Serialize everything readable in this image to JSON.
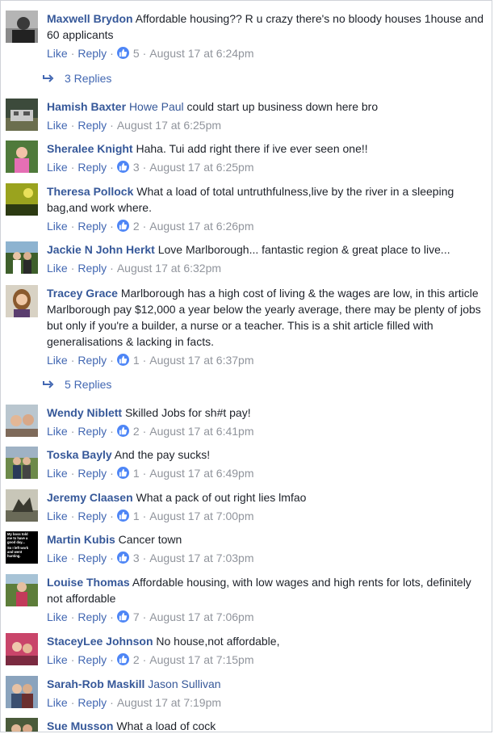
{
  "labels": {
    "like": "Like",
    "reply": "Reply",
    "separator": "·"
  },
  "comments": [
    {
      "author": "Maxwell Brydon",
      "mention": "",
      "text": "Affordable housing?? R u crazy there's no bloody houses 1house and 60 applicants",
      "reactions": "5",
      "time": "August 17 at 6:24pm"
    },
    {
      "author": "Hamish Baxter",
      "mention": "Howe Paul",
      "text": "could start up business down here bro",
      "reactions": "",
      "time": "August 17 at 6:25pm"
    },
    {
      "author": "Sheralee Knight",
      "mention": "",
      "text": "Haha. Tui add right there if ive ever seen one!!",
      "reactions": "3",
      "time": "August 17 at 6:25pm"
    },
    {
      "author": "Theresa Pollock",
      "mention": "",
      "text": "What a load of total untruthfulness,live by the river in a sleeping bag,and work where.",
      "reactions": "2",
      "time": "August 17 at 6:26pm"
    },
    {
      "author": "Jackie N John Herkt",
      "mention": "",
      "text": "Love Marlborough... fantastic region & great place to live...",
      "reactions": "",
      "time": "August 17 at 6:32pm"
    },
    {
      "author": "Tracey Grace",
      "mention": "",
      "text": "Marlborough has a high cost of living & the wages are low, in this article Marlborough pay $12,000 a year below the yearly average, there may be plenty of jobs but only if you're a builder, a nurse or a teacher. This is a shit article filled with generalisations & lacking in facts.",
      "reactions": "1",
      "time": "August 17 at 6:37pm"
    },
    {
      "author": "Wendy Niblett",
      "mention": "",
      "text": "Skilled Jobs for sh#t pay!",
      "reactions": "2",
      "time": "August 17 at 6:41pm"
    },
    {
      "author": "Toska Bayly",
      "mention": "",
      "text": "And the pay sucks!",
      "reactions": "1",
      "time": "August 17 at 6:49pm"
    },
    {
      "author": "Jeremy Claasen",
      "mention": "",
      "text": "What a pack of out right lies lmfao",
      "reactions": "1",
      "time": "August 17 at 7:00pm"
    },
    {
      "author": "Martin Kubis",
      "mention": "",
      "text": "Cancer town",
      "reactions": "3",
      "time": "August 17 at 7:03pm",
      "avatar_text": [
        "My boss told",
        "me to have a",
        "good day...",
        "",
        "So I left work",
        "and went",
        "hunting."
      ]
    },
    {
      "author": "Louise Thomas",
      "mention": "",
      "text": "Affordable housing, with low wages and high rents for lots, definitely not affordable",
      "reactions": "7",
      "time": "August 17 at 7:06pm"
    },
    {
      "author": "StaceyLee Johnson",
      "mention": "",
      "text": "No house,not affordable,",
      "reactions": "2",
      "time": "August 17 at 7:15pm"
    },
    {
      "author": "Sarah-Rob Maskill",
      "mention": "Jason Sullivan",
      "text": "",
      "reactions": "",
      "time": "August 17 at 7:19pm"
    },
    {
      "author": "Sue Musson",
      "mention": "",
      "text": "What a load of cock",
      "reactions": "",
      "time": ""
    }
  ],
  "reply_threads": [
    {
      "label": "3 Replies"
    },
    {
      "label": "5 Replies"
    }
  ],
  "colors": {
    "link": "#365899",
    "action_link": "#4267b2",
    "meta": "#90949c",
    "like_badge": "#4e86f6"
  }
}
